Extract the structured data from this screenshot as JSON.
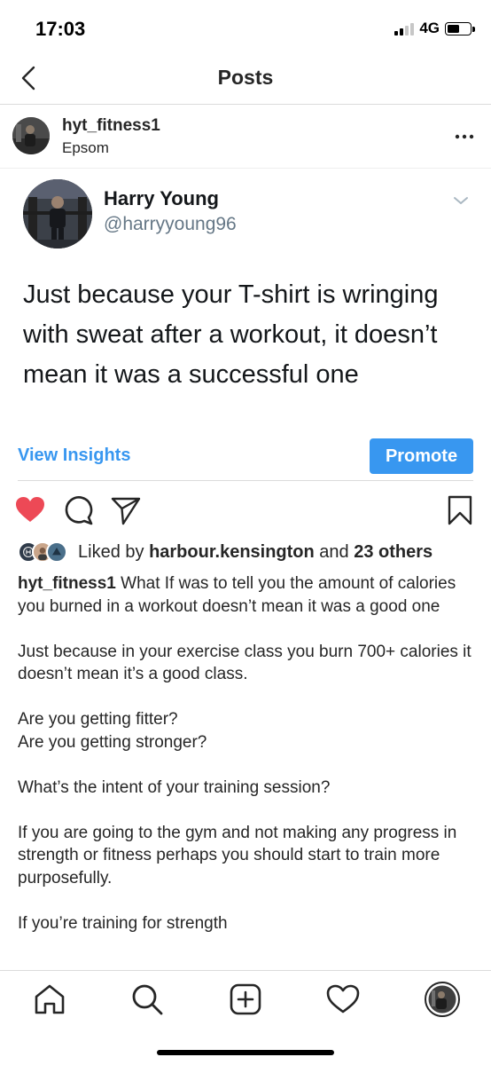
{
  "status_bar": {
    "time": "17:03",
    "network": "4G",
    "signal_bars": 2,
    "signal_total": 4,
    "battery_level": 0.55
  },
  "nav": {
    "title": "Posts",
    "back_icon": "chevron-left-icon"
  },
  "post_header": {
    "username": "hyt_fitness1",
    "location": "Epsom",
    "more_icon": "more-horizontal-icon"
  },
  "tweet": {
    "name": "Harry Young",
    "handle": "@harryyoung96",
    "text": "Just because your T-shirt is wringing with sweat after a workout, it doesn’t mean it was a successful one"
  },
  "insights": {
    "view_insights_label": "View Insights",
    "promote_label": "Promote"
  },
  "actions": {
    "like_icon": "heart-filled-icon",
    "comment_icon": "comment-icon",
    "share_icon": "send-icon",
    "save_icon": "bookmark-icon",
    "like_color": "#ed4956"
  },
  "likes": {
    "prefix": "Liked by ",
    "first_user": "harbour.kensington",
    "middle": " and ",
    "others": "23 others"
  },
  "caption": {
    "username": "hyt_fitness1",
    "first_line": " What If was to tell you the amount of calories you burned in a workout doesn’t mean it was a good one",
    "paragraph_2": "Just because in your exercise class you burn 700+ calories it doesn’t mean it’s a good class.",
    "paragraph_3a": "Are you getting fitter?",
    "paragraph_3b": "Are you getting stronger?",
    "paragraph_4": "What’s the intent of your training session?",
    "paragraph_5": "If you are going to the gym and not making any progress in strength or fitness perhaps you should start to train more purposefully.",
    "paragraph_6": "If you’re training for strength"
  },
  "tab_bar": {
    "home_icon": "home-icon",
    "search_icon": "search-icon",
    "add_icon": "add-post-icon",
    "activity_icon": "heart-outline-icon",
    "profile_icon": "profile-avatar-icon"
  },
  "colors": {
    "accent": "#3897f0",
    "like": "#ed4956",
    "text": "#262626",
    "handle": "#657786",
    "divider": "#dbdbdb"
  }
}
